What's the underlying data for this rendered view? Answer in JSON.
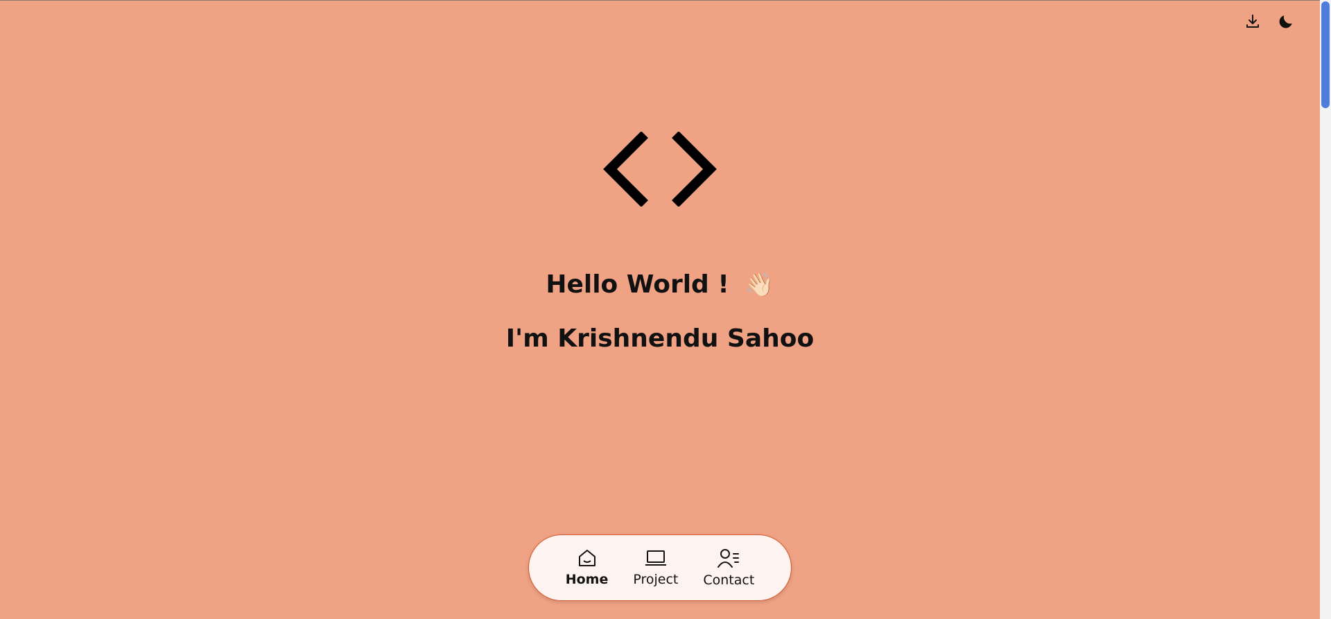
{
  "top_actions": {
    "download_icon": "download-icon",
    "theme_icon": "moon-icon"
  },
  "logo": {
    "icon": "code-brackets-icon"
  },
  "hero": {
    "greeting": "Hello World !",
    "wave_emoji": "👋🏻",
    "name_line": "I'm Krishnendu Sahoo"
  },
  "nav": {
    "items": [
      {
        "label": "Home",
        "icon": "home-icon",
        "active": true
      },
      {
        "label": "Project",
        "icon": "laptop-icon",
        "active": false
      },
      {
        "label": "Contact",
        "icon": "contact-icon",
        "active": false
      }
    ]
  },
  "colors": {
    "background": "#f0a284",
    "nav_background": "#fdf4f1",
    "nav_border": "#d75a2c",
    "scroll_thumb": "#4f7ddb"
  }
}
